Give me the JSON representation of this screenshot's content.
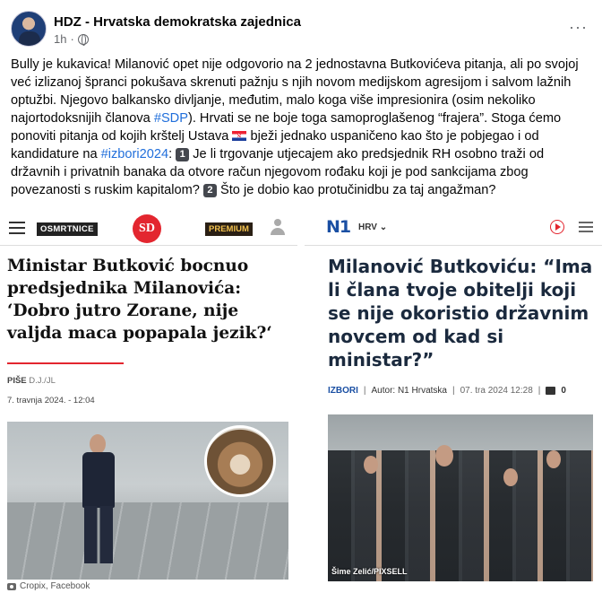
{
  "post": {
    "page_name": "HDZ - Hrvatska demokratska zajednica",
    "time": "1h",
    "privacy_separator": "·",
    "more_label": "···",
    "text_part1": "Bully je kukavica! Milanović opet nije odgovorio na 2 jednostavna Butkovićeva pitanja, ali po svojoj već izlizanoj špranci pokušava skrenuti pažnju s njih novom medijskom agresijom i salvom lažnih optužbi. Njegovo balkansko divljanje, međutim, malo koga više impresionira (osim nekoliko najortodoksnijih članova ",
    "hashtag_sdp": "#SDP",
    "text_part2": "). Hrvati se ne boje toga samoproglašenog “frajera”. Stoga ćemo ponoviti pitanja od kojih krštelj Ustava ",
    "text_part3": " bježi jednako uspaničeno kao što je pobjegao i od kandidature na ",
    "hashtag_izbori": "#izbori2024",
    "text_part4": ": ",
    "badge1": "1",
    "question1": " Je li trgovanje utjecajem ako predsjednik RH osobno traži od državnih i privatnih banaka da otvore račun njegovom rođaku koji je pod sankcijama zbog povezanosti s ruskim kapitalom? ",
    "badge2": "2",
    "question2": " Što je dobio kao protučinidbu za taj angažman?"
  },
  "left_article": {
    "osmrtnice": "OSMRTNICE",
    "logo": "SD",
    "premium": "PREMIUM",
    "headline": "Ministar Butković bocnuo predsjednika Milanovića: ‘Dobro jutro Zorane, nije valjda maca popapala jezik?‘",
    "author_label": "PIŠE",
    "author": "D.J./JL",
    "date": "7. travnja 2024. - 12:04",
    "credit": "Cropix, Facebook"
  },
  "right_article": {
    "logo": "N1",
    "edition": "HRV ⌄",
    "headline": "Milanović Butkoviću: “Ima li člana tvoje obitelji koji se nije okoristio državnim novcem od kad si ministar?”",
    "section": "IZBORI",
    "author": "Autor: N1 Hrvatska",
    "date": "07. tra 2024 12:28",
    "comments": "0",
    "credit": "Šime Zelić/PIXSELL"
  }
}
